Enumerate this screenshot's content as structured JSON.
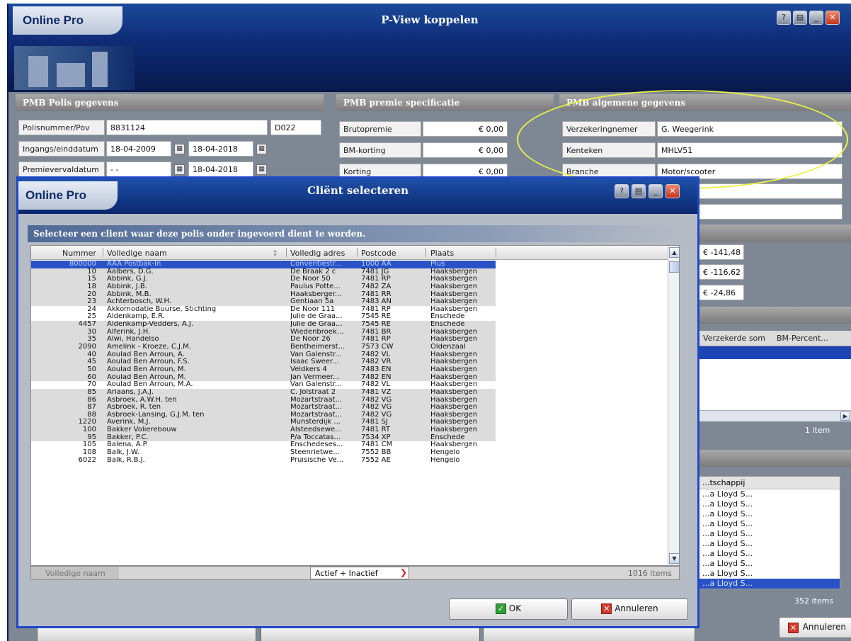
{
  "background_window": {
    "brand": "Online Pro",
    "title": "P-View koppelen",
    "polis_panel": {
      "heading": "PMB Polis gegevens",
      "row1": {
        "label": "Polisnummer/Pov",
        "value": "8831124",
        "code": "D022"
      },
      "row2": {
        "label": "Ingangs/einddatum",
        "start": "18-04-2009",
        "end": "18-04-2018"
      },
      "row3": {
        "label": "Premievervaldatum",
        "start": "- -",
        "end": "18-04-2018"
      }
    },
    "premie_panel": {
      "heading": "PMB premie specificatie",
      "rows": [
        {
          "label": "Brutopremie",
          "value": "€ 0,00"
        },
        {
          "label": "BM-korting",
          "value": "€ 0,00"
        },
        {
          "label": "Korting",
          "value": "€ 0,00"
        }
      ],
      "side_values": [
        "€ -141,48",
        "€ -116,62",
        "€ -24,86"
      ]
    },
    "algemeen_panel": {
      "heading": "PMB algemene gegevens",
      "rows": [
        {
          "label": "Verzekeringnemer",
          "value": "G. Weegerink"
        },
        {
          "label": "Kenteken",
          "value": "MHLV51"
        },
        {
          "label": "Branche",
          "value": "Motor/scooter"
        }
      ]
    },
    "table_columns": [
      "Verzekerde som",
      "BM-Percent..."
    ],
    "table_count": "1 item",
    "list2_header": "...tschappij",
    "list2_item": "...a Lloyd S...",
    "list2_count": "352 items",
    "cancel_label": "Annuleren"
  },
  "dialog": {
    "brand": "Online Pro",
    "title": "Cliënt selecteren",
    "instruction": "Selecteer een client waar deze polis onder ingevoerd dient te worden.",
    "columns": {
      "number": "Nummer",
      "name": "Volledige naam",
      "address": "Volledig adres",
      "postcode": "Postcode",
      "city": "Plaats"
    },
    "rows": [
      {
        "number": "800000",
        "name": "AAA Postbak-In",
        "address": "Conventiestr...",
        "postcode": "1000 AA",
        "city": "Plus"
      },
      {
        "number": "10",
        "name": "Aalbers, D.G.",
        "address": "De Braak 2 c",
        "postcode": "7481 JG",
        "city": "Haaksbergen"
      },
      {
        "number": "15",
        "name": "Abbink, G.J.",
        "address": "De Noor 50",
        "postcode": "7481 RP",
        "city": "Haaksbergen"
      },
      {
        "number": "18",
        "name": "Abbink, J.B.",
        "address": "Paulus Potte...",
        "postcode": "7482 ZA",
        "city": "Haaksbergen"
      },
      {
        "number": "20",
        "name": "Abbink, M.B.",
        "address": "Haaksberger...",
        "postcode": "7481 RR",
        "city": "Haaksbergen"
      },
      {
        "number": "23",
        "name": "Achterbosch, W.H.",
        "address": "Gentiaan 5a",
        "postcode": "7483 AN",
        "city": "Haaksbergen"
      },
      {
        "number": "24",
        "name": "Akkomodatie Buurse, Stichting",
        "address": "De Noor 111",
        "postcode": "7481 RP",
        "city": "Haaksbergen"
      },
      {
        "number": "25",
        "name": "Aldenkamp, E.R.",
        "address": "Julie de Graa...",
        "postcode": "7545 RE",
        "city": "Enschede"
      },
      {
        "number": "4457",
        "name": "Aldenkamp-Vedders, A.J.",
        "address": "Julie de Graa...",
        "postcode": "7545 RE",
        "city": "Enschede"
      },
      {
        "number": "30",
        "name": "Alferink, J.H.",
        "address": "Wiedenbroek...",
        "postcode": "7481 BR",
        "city": "Haaksbergen"
      },
      {
        "number": "35",
        "name": "Alwi, Handelso",
        "address": "De Noor 26",
        "postcode": "7481 RP",
        "city": "Haaksbergen"
      },
      {
        "number": "2090",
        "name": "Amelink - Kroeze, C.J.M.",
        "address": "Bentheimerst...",
        "postcode": "7573 CW",
        "city": "Oldenzaal"
      },
      {
        "number": "40",
        "name": "Aoulad Ben Arroun, A.",
        "address": "Van Galenstr...",
        "postcode": "7482 VL",
        "city": "Haaksbergen"
      },
      {
        "number": "45",
        "name": "Aoulad Ben Arroun, F.S.",
        "address": "Isaac Sweer...",
        "postcode": "7482 VR",
        "city": "Haaksbergen"
      },
      {
        "number": "50",
        "name": "Aoulad Ben Arroun, M.",
        "address": "Veldkers 4",
        "postcode": "7483 EN",
        "city": "Haaksbergen"
      },
      {
        "number": "60",
        "name": "Aoulad Ben Arroun, M.",
        "address": "Jan Vermeer...",
        "postcode": "7482 EN",
        "city": "Haaksbergen"
      },
      {
        "number": "70",
        "name": "Aoulad Ben Arroun, M.A.",
        "address": "Van Galenstr...",
        "postcode": "7482 VL",
        "city": "Haaksbergen"
      },
      {
        "number": "85",
        "name": "Ariaans, J.A.J.",
        "address": "C. Jolstraat 2",
        "postcode": "7481 VZ",
        "city": "Haaksbergen"
      },
      {
        "number": "86",
        "name": "Asbroek, A.W.H. ten",
        "address": "Mozartstraat...",
        "postcode": "7482 VG",
        "city": "Haaksbergen"
      },
      {
        "number": "87",
        "name": "Asbroek, R. ten",
        "address": "Mozartstraat...",
        "postcode": "7482 VG",
        "city": "Haaksbergen"
      },
      {
        "number": "88",
        "name": "Asbroek-Lansing, G.J.M. ten",
        "address": "Mozartstraat...",
        "postcode": "7482 VG",
        "city": "Haaksbergen"
      },
      {
        "number": "1220",
        "name": "Averink, M.J.",
        "address": "Munsterdijk ...",
        "postcode": "7481 SJ",
        "city": "Haaksbergen"
      },
      {
        "number": "100",
        "name": "Bakker Volierebouw",
        "address": "Alsteedsewe...",
        "postcode": "7481 RT",
        "city": "Haaksbergen"
      },
      {
        "number": "95",
        "name": "Bakker, P.C.",
        "address": "P/a Toccatas...",
        "postcode": "7534 XP",
        "city": "Enschede"
      },
      {
        "number": "105",
        "name": "Balena, A.P.",
        "address": "Enschedeses...",
        "postcode": "7481 CM",
        "city": "Haaksbergen"
      },
      {
        "number": "108",
        "name": "Balk, J.W.",
        "address": "Steenrietwe...",
        "postcode": "7552 BB",
        "city": "Hengelo"
      },
      {
        "number": "6022",
        "name": "Balk, R.B.J.",
        "address": "Pruisische Ve...",
        "postcode": "7552 AE",
        "city": "Hengelo"
      }
    ],
    "filter_placeholder": "Volledige naam",
    "status_filter": "Actief + Inactief",
    "item_count": "1016 items",
    "ok_label": "OK",
    "cancel_label": "Annuleren"
  }
}
